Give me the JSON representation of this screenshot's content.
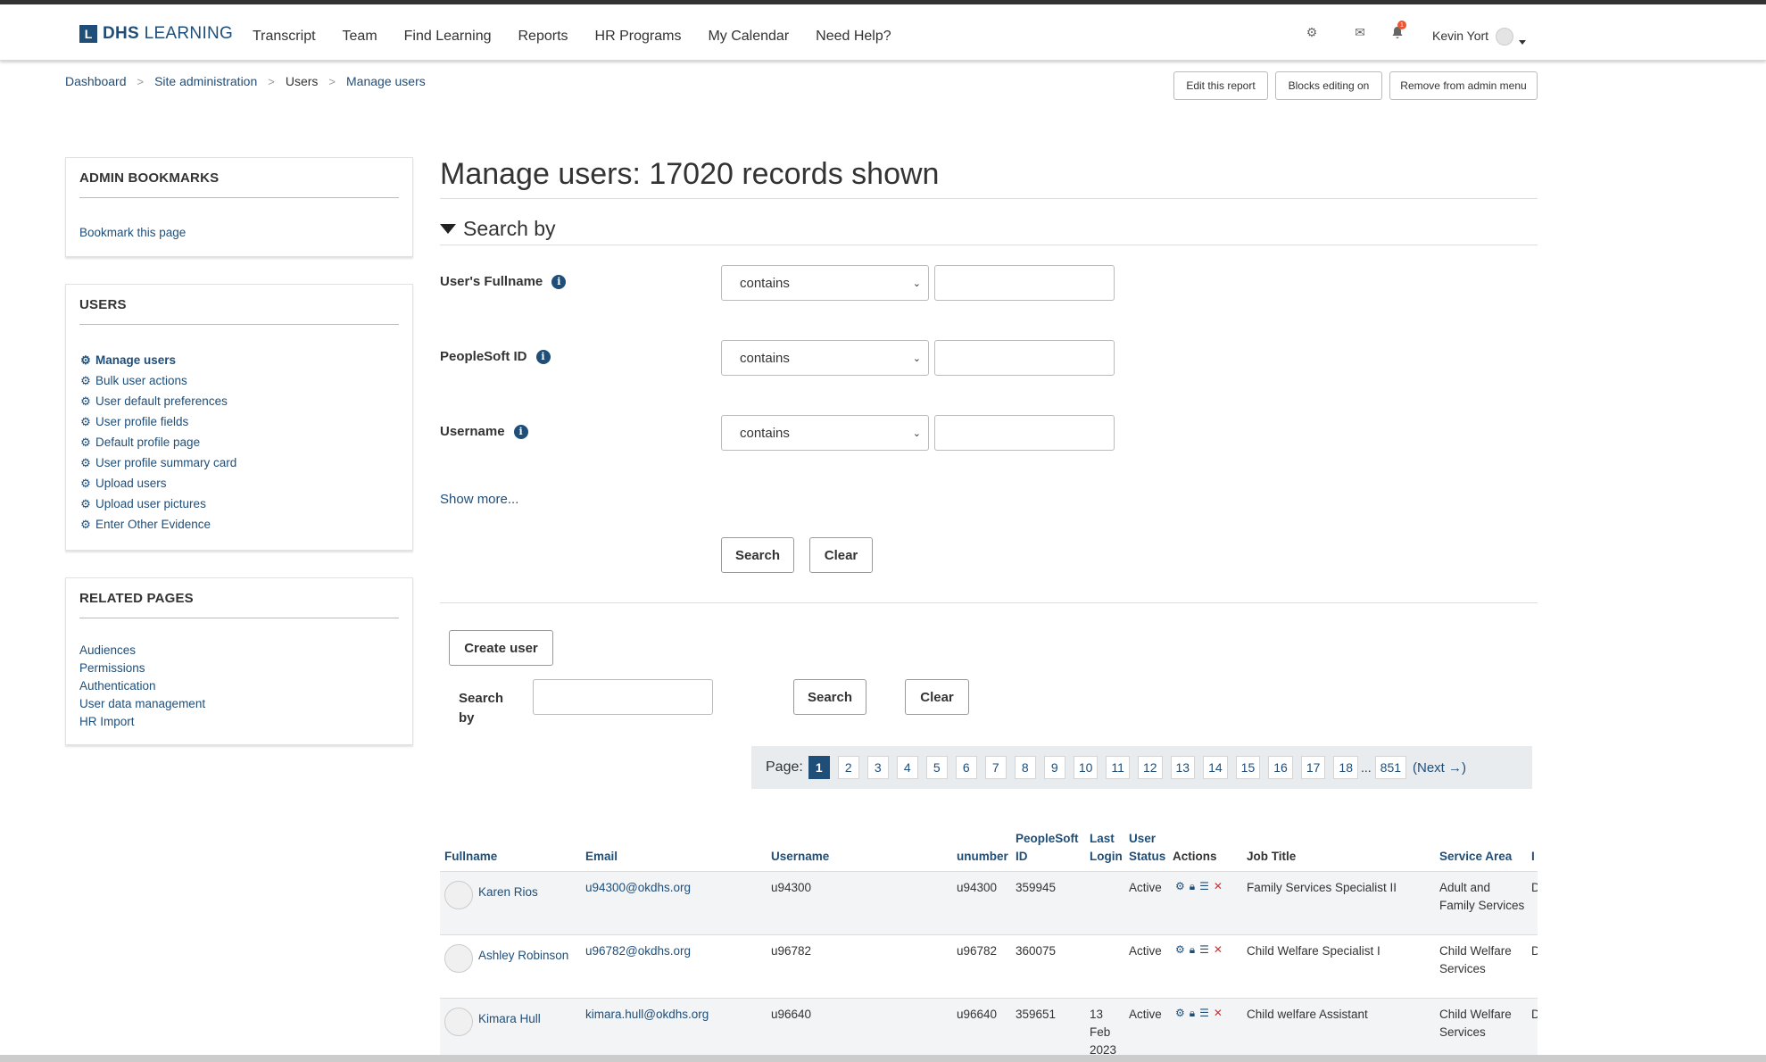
{
  "brand": {
    "mark": "L",
    "name_bold": "DHS",
    "name_rest": " LEARNING"
  },
  "nav": [
    "Transcript",
    "Team",
    "Find Learning",
    "Reports",
    "HR Programs",
    "My Calendar",
    "Need Help?"
  ],
  "header": {
    "user_name": "Kevin Yort",
    "notification_count": "1"
  },
  "breadcrumb": [
    "Dashboard",
    "Site administration",
    "Users",
    "Manage users"
  ],
  "page_buttons": {
    "edit_report": "Edit this report",
    "blocks_editing": "Blocks editing on",
    "remove_menu": "Remove from admin menu"
  },
  "sidebar": {
    "bookmarks": {
      "title": "ADMIN BOOKMARKS",
      "link": "Bookmark this page"
    },
    "users": {
      "title": "USERS",
      "items": [
        "Manage users",
        "Bulk user actions",
        "User default preferences",
        "User profile fields",
        "Default profile page",
        "User profile summary card",
        "Upload users",
        "Upload user pictures",
        "Enter Other Evidence"
      ]
    },
    "related": {
      "title": "RELATED PAGES",
      "items": [
        "Audiences",
        "Permissions",
        "Authentication",
        "User data management",
        "HR Import"
      ]
    }
  },
  "main": {
    "title": "Manage users: 17020 records shown",
    "search_heading": "Search by",
    "fields": [
      {
        "label": "User's Fullname",
        "operator": "contains",
        "value": ""
      },
      {
        "label": "PeopleSoft ID",
        "operator": "contains",
        "value": ""
      },
      {
        "label": "Username",
        "operator": "contains",
        "value": ""
      }
    ],
    "show_more": "Show more...",
    "search_button": "Search",
    "clear_button": "Clear",
    "create_user": "Create user",
    "simple_search_label": "Search by",
    "simple_search_value": "",
    "simple_search_button": "Search",
    "simple_clear_button": "Clear"
  },
  "paging": {
    "label": "Page:",
    "pages": [
      "1",
      "2",
      "3",
      "4",
      "5",
      "6",
      "7",
      "8",
      "9",
      "10",
      "11",
      "12",
      "13",
      "14",
      "15",
      "16",
      "17",
      "18"
    ],
    "ellipsis": "...",
    "last": "851",
    "next": "(Next →)",
    "current": "1"
  },
  "table": {
    "columns": [
      "Fullname",
      "Email",
      "Username",
      "unumber",
      "PeopleSoft ID",
      "Last Login",
      "User Status",
      "Actions",
      "Job Title",
      "Service Area",
      "I"
    ],
    "rows": [
      {
        "fullname": "Karen Rios",
        "email": "u94300@okdhs.org",
        "username": "u94300",
        "unumber": "u94300",
        "peoplesoft_id": "359945",
        "last_login": "",
        "status": "Active",
        "job_title": "Family Services Specialist II",
        "service_area": "Adult and Family Services",
        "extra": "D"
      },
      {
        "fullname": "Ashley Robinson",
        "email": "u96782@okdhs.org",
        "username": "u96782",
        "unumber": "u96782",
        "peoplesoft_id": "360075",
        "last_login": "",
        "status": "Active",
        "job_title": "Child Welfare Specialist I",
        "service_area": "Child Welfare Services",
        "extra": "D"
      },
      {
        "fullname": "Kimara Hull",
        "email": "kimara.hull@okdhs.org",
        "username": "u96640",
        "unumber": "u96640",
        "peoplesoft_id": "359651",
        "last_login": "13 Feb 2023",
        "status": "Active",
        "job_title": "Child welfare Assistant",
        "service_area": "Child Welfare Services",
        "extra": "D"
      }
    ]
  },
  "colors": {
    "brand": "#1f4e79",
    "link": "#1f4e79",
    "badge": "#ee5533"
  }
}
